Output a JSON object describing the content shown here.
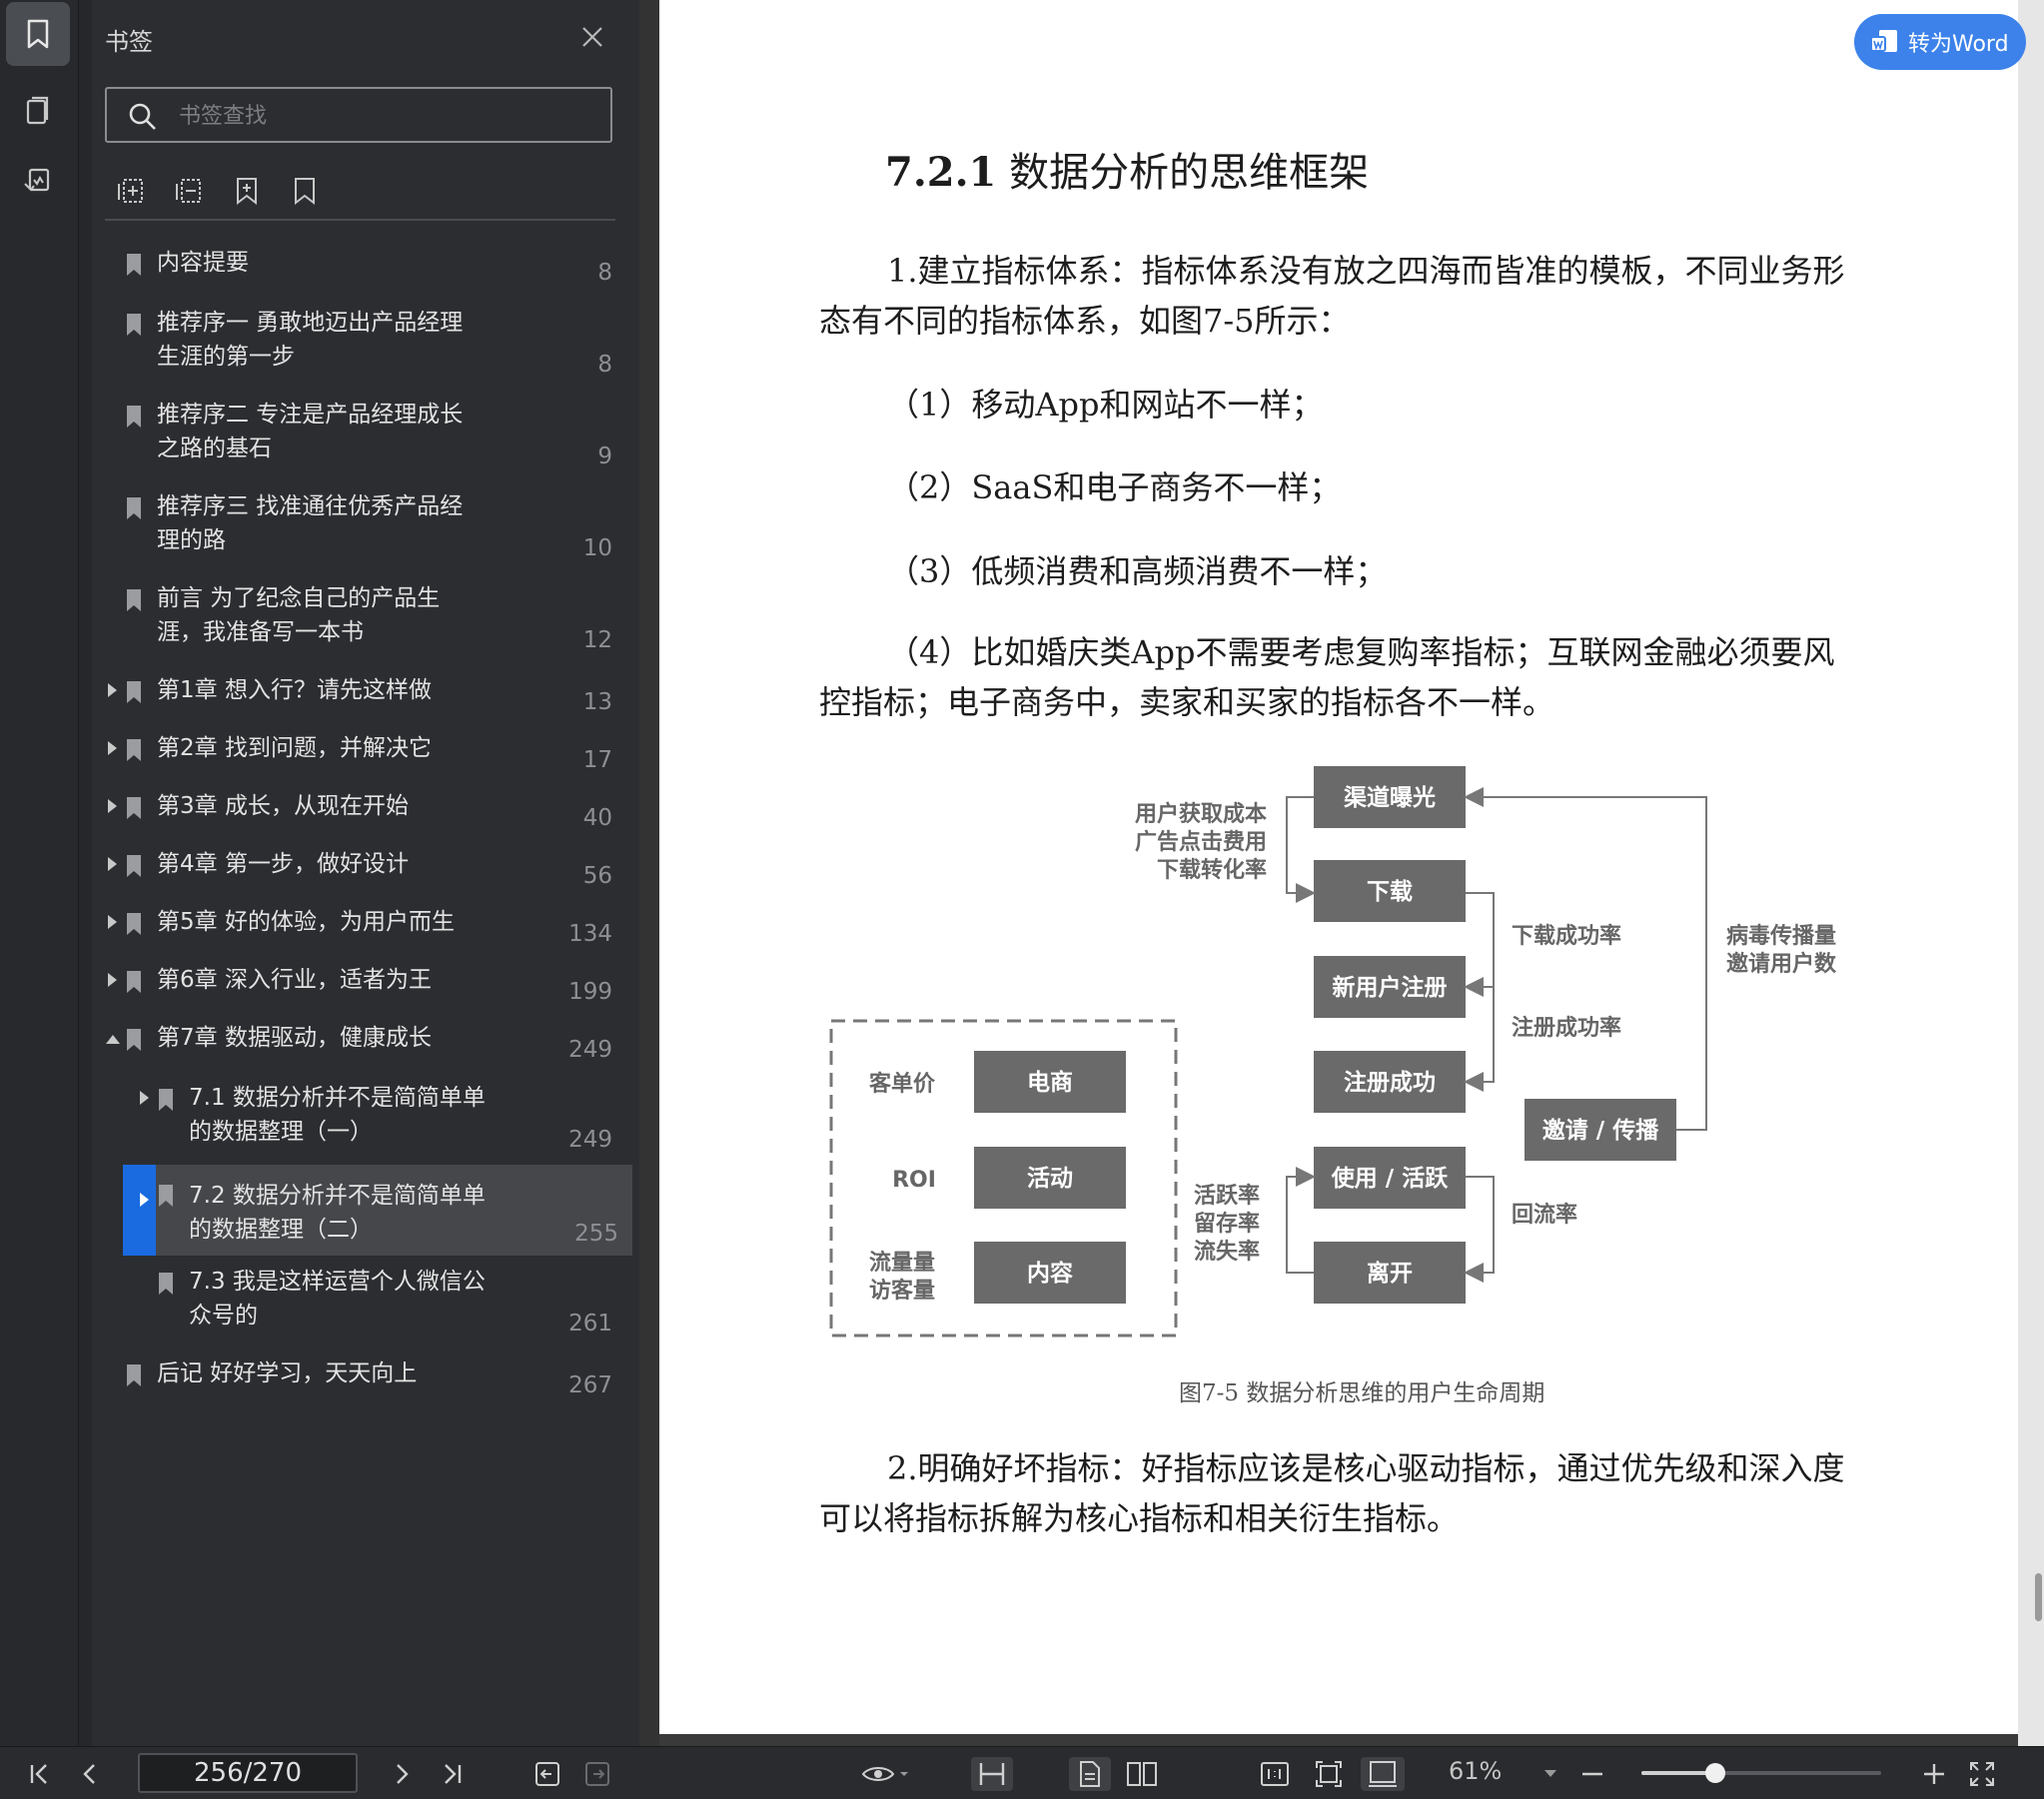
{
  "sidebar": {
    "title": "书签",
    "search_placeholder": "书签查找",
    "bookmarks": [
      {
        "label": "内容提要",
        "page": "8"
      },
      {
        "label": "推荐序一 勇敢地迈出产品经理生涯的第一步",
        "page": "8"
      },
      {
        "label": "推荐序二 专注是产品经理成长之路的基石",
        "page": "9"
      },
      {
        "label": "推荐序三 找准通往优秀产品经理的路",
        "page": "10"
      },
      {
        "label": "前言 为了纪念自己的产品生涯，我准备写一本书",
        "page": "12"
      },
      {
        "label": "第1章 想入行？请先这样做",
        "page": "13"
      },
      {
        "label": "第2章 找到问题，并解决它",
        "page": "17"
      },
      {
        "label": "第3章 成长，从现在开始",
        "page": "40"
      },
      {
        "label": "第4章 第一步，做好设计",
        "page": "56"
      },
      {
        "label": "第5章 好的体验，为用户而生",
        "page": "134"
      },
      {
        "label": "第6章 深入行业，适者为王",
        "page": "199"
      },
      {
        "label": "第7章 数据驱动，健康成长",
        "page": "249"
      },
      {
        "label": "7.1 数据分析并不是简简单单的数据整理（一）",
        "page": "249"
      },
      {
        "label": "7.2 数据分析并不是简简单单的数据整理（二）",
        "page": "255"
      },
      {
        "label": "7.3 我是这样运营个人微信公众号的",
        "page": "261"
      },
      {
        "label": "后记 好好学习，天天向上",
        "page": "267"
      }
    ]
  },
  "document": {
    "convert_button": "转为Word",
    "heading_num": "7.2.1",
    "heading_text": " 数据分析的思维框架",
    "para1": "1.建立指标体系：指标体系没有放之四海而皆准的模板，不同业务形态有不同的指标体系，如图7-5所示：",
    "item1": "（1）移动App和网站不一样；",
    "item2": "（2）SaaS和电子商务不一样；",
    "item3": "（3）低频消费和高频消费不一样；",
    "para2": "（4）比如婚庆类App不需要考虑复购率指标；互联网金融必须要风控指标；电子商务中，卖家和买家的指标各不一样。",
    "figure": {
      "boxes": {
        "channel": "渠道曝光",
        "download": "下载",
        "register": "新用户注册",
        "reg_success": "注册成功",
        "use": "使用 / 活跃",
        "leave": "离开",
        "invite": "邀请 / 传播",
        "ecommerce": "电商",
        "activity": "活动",
        "content": "内容"
      },
      "labels": {
        "cost1": "用户获取成本",
        "cost2": "广告点击费用",
        "cost3": "下载转化率",
        "dl_rate": "下载成功率",
        "reg_rate": "注册成功率",
        "viral1": "病毒传播量",
        "viral2": "邀请用户数",
        "active1": "活跃率",
        "active2": "留存率",
        "active3": "流失率",
        "return": "回流率",
        "unit_price": "客单价",
        "roi": "ROI",
        "traffic1": "流量量",
        "traffic2": "访客量"
      }
    },
    "caption": "图7-5 数据分析思维的用户生命周期",
    "para3": "2.明确好坏指标：好指标应该是核心驱动指标，通过优先级和深入度可以将指标拆解为核心指标和相关衍生指标。"
  },
  "toolbar": {
    "page_indicator": "256/270",
    "zoom": "61%",
    "zoom_level": 0.31
  }
}
